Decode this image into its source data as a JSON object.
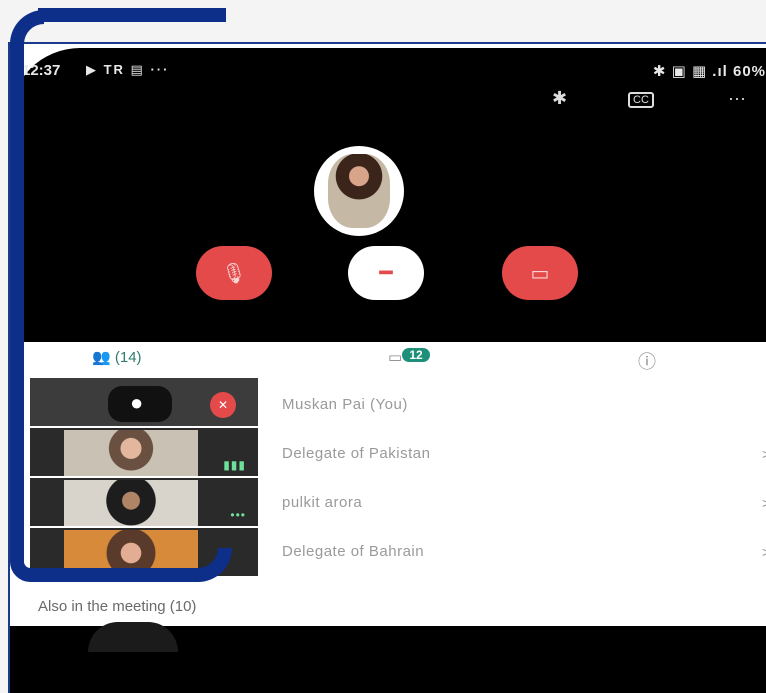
{
  "status_bar": {
    "time": "12:37",
    "left_icons": "▶ TR ▤ ···",
    "right": "✱ ▣ ▦ .ıl 60%"
  },
  "toolbar": {
    "bluetooth_icon": "✱",
    "captions_icon": "CC",
    "more_icon": "···"
  },
  "tabs": {
    "people_count": "(14)",
    "chat_count": "12",
    "info_icon": "ⓘ"
  },
  "participants": [
    {
      "name": "Muskan Pai (You)",
      "chevron": ""
    },
    {
      "name": "Delegate of Pakistan",
      "chevron": ">"
    },
    {
      "name": "pulkit arora",
      "chevron": ">"
    },
    {
      "name": "Delegate of Bahrain",
      "chevron": ">"
    }
  ],
  "also_in_meeting": "Also in the meeting (10)",
  "colors": {
    "accent": "#1e8f79",
    "danger": "#e44a4a",
    "frame": "#0d2f8a"
  }
}
